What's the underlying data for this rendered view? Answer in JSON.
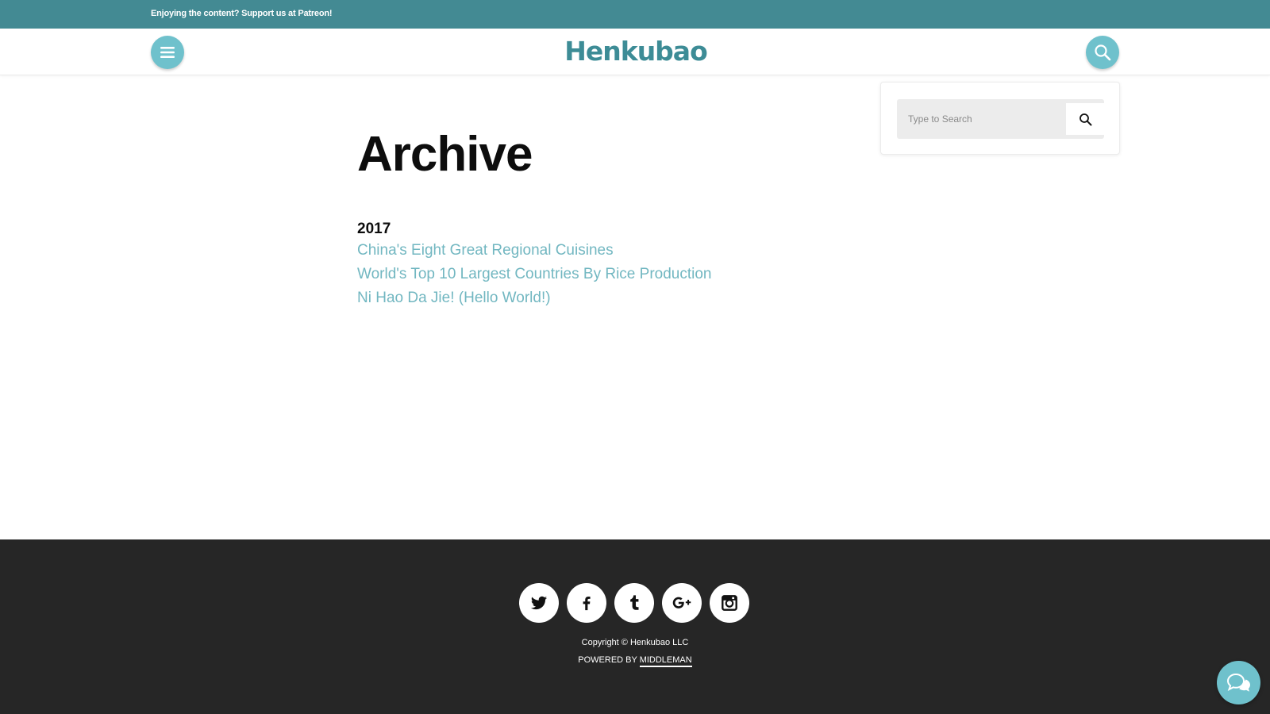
{
  "topbar": {
    "message": "Enjoying the content? Support us at",
    "link": "Patreon",
    "suffix": "!"
  },
  "header": {
    "logo": "Henkubao",
    "menu_icon": "hamburger-menu-icon",
    "search_icon": "search-icon"
  },
  "search": {
    "placeholder": "Type to Search",
    "submit_icon": "search-icon"
  },
  "main": {
    "title": "Archive",
    "year": "2017",
    "posts": [
      "China's Eight Great Regional Cuisines",
      "World's Top 10 Largest Countries By Rice Production",
      "Ni Hao Da Jie! (Hello World!)"
    ]
  },
  "footer": {
    "social": [
      "twitter-icon",
      "facebook-icon",
      "tumblr-icon",
      "google-plus-icon",
      "instagram-icon"
    ],
    "copyright": "Copyright © Henkubao LLC",
    "powered_prefix": "POWERED BY",
    "powered_link": "MIDDLEMAN"
  },
  "chat": {
    "icon": "chat-bubble-icon"
  },
  "colors": {
    "topbar": "#438a93",
    "accent": "#6fc1cc",
    "link": "#72b7c1",
    "logo": "#3d8c96",
    "footer": "#262626"
  }
}
